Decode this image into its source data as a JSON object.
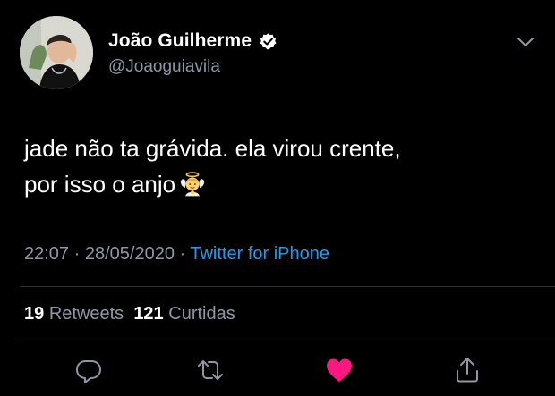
{
  "tweet": {
    "author": {
      "display_name": "João Guilherme",
      "handle": "@Joaoguiavila",
      "verified": true
    },
    "text_lines": [
      "jade não ta grávida. ela virou crente,",
      "por isso o anjo"
    ],
    "emoji": "baby-angel",
    "time": "22:07",
    "separator": " · ",
    "date": "28/05/2020",
    "source": "Twitter for iPhone",
    "stats": {
      "retweets_count": "19",
      "retweets_label": "Retweets",
      "likes_count": "121",
      "likes_label": "Curtidas"
    },
    "liked": true
  },
  "colors": {
    "background": "#000000",
    "text_primary": "#ffffff",
    "text_secondary": "#8b98a5",
    "accent": "#1d9bf0",
    "like": "#f91880",
    "divider": "#2f3336"
  },
  "icons": {
    "more": "chevron-down-icon",
    "verified": "verified-badge-icon",
    "reply": "reply-icon",
    "retweet": "retweet-icon",
    "like": "heart-icon",
    "share": "share-icon"
  }
}
